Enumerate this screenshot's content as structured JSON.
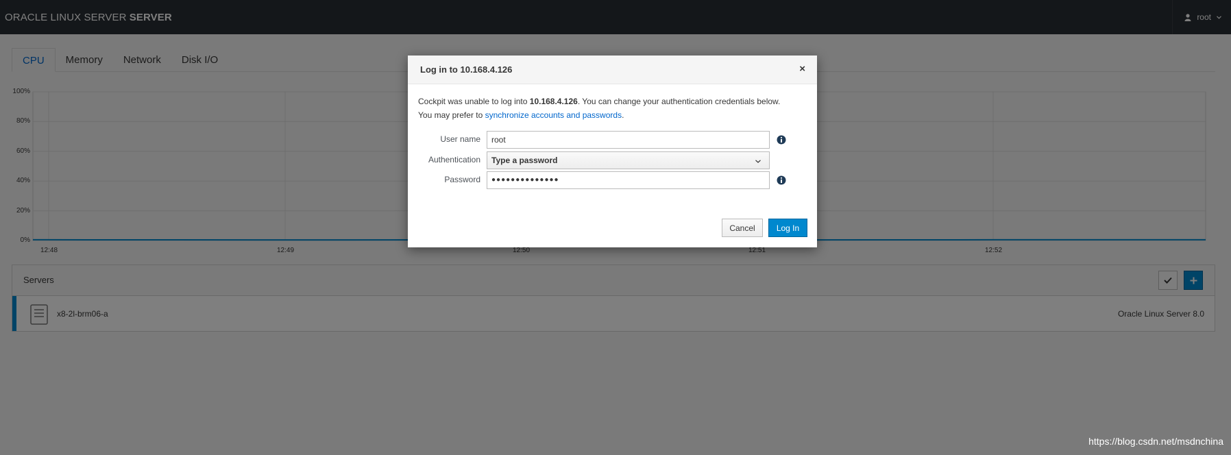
{
  "topbar": {
    "brand_prefix": "ORACLE LINUX SERVER",
    "brand_suffix": "SERVER",
    "user": "root",
    "user_icon": "user-icon",
    "chevron_icon": "chevron-down-icon"
  },
  "tabs": [
    {
      "label": "CPU",
      "active": true
    },
    {
      "label": "Memory"
    },
    {
      "label": "Network"
    },
    {
      "label": "Disk I/O"
    }
  ],
  "chart_data": {
    "type": "line",
    "title": "",
    "xlabel": "",
    "ylabel": "",
    "y_ticks": [
      "100%",
      "80%",
      "60%",
      "40%",
      "20%",
      "0%"
    ],
    "ylim": [
      0,
      100
    ],
    "x_ticks": [
      "12:48",
      "12:49",
      "12:50",
      "12:51",
      "12:52"
    ],
    "series": [
      {
        "x": [
          "12:48",
          "12:49",
          "12:50",
          "12:51",
          "12:52"
        ],
        "y": [
          0.5,
          0.4,
          0.5,
          0.4,
          0.5
        ]
      }
    ],
    "grid": true
  },
  "servers": {
    "title": "Servers",
    "check_icon": "checkmark-icon",
    "add_icon": "plus-icon",
    "rows": [
      {
        "name": "x8-2l-brm06-a",
        "os": "Oracle Linux Server 8.0",
        "icon": "server-icon"
      }
    ]
  },
  "dialog": {
    "title": "Log in to 10.168.4.126",
    "close": "×",
    "msg_before": "Cockpit was unable to log into ",
    "msg_host": "10.168.4.126",
    "msg_after": ". You can change your authentication credentials below.",
    "msg_line2_prefix": "You may prefer to ",
    "msg_link": "synchronize accounts and passwords",
    "msg_line2_suffix": ".",
    "username_label": "User name",
    "username_value": "root",
    "auth_label": "Authentication",
    "auth_value": "Type a password",
    "password_label": "Password",
    "password_value": "●●●●●●●●●●●●●●",
    "info_icon": "info-icon",
    "cancel_label": "Cancel",
    "login_label": "Log In",
    "accent_color": "#0088ce"
  },
  "watermark": "https://blog.csdn.net/msdnchina"
}
